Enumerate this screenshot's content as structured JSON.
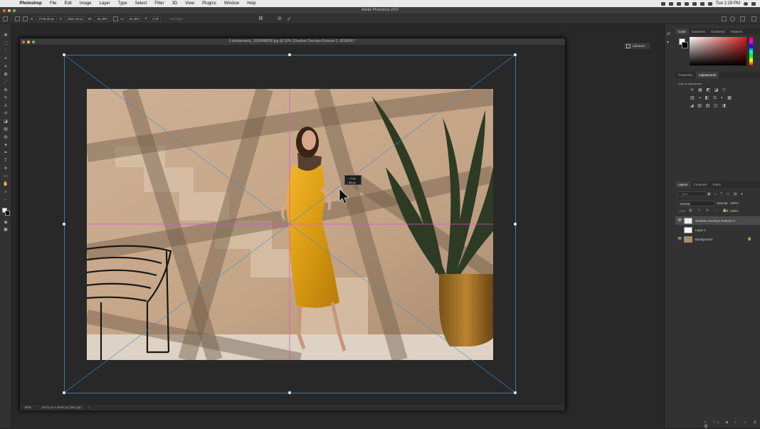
{
  "menubar": {
    "app": "Photoshop",
    "items": [
      "File",
      "Edit",
      "Image",
      "Layer",
      "Type",
      "Select",
      "Filter",
      "3D",
      "View",
      "Plugins",
      "Window",
      "Help"
    ],
    "clock": "Tue 1:29 PM"
  },
  "titlebar": {
    "title": "Adobe Photoshop 2022"
  },
  "options": {
    "x_label": "X:",
    "x_value": "2736.00 px",
    "y_label": "Y:",
    "y_value": "1824.00 px",
    "w_label": "W:",
    "w_value": "36.49%",
    "h_label": "H:",
    "h_value": "36.49%",
    "angle_value": "0.00",
    "interp_label": "Anti-alias"
  },
  "document": {
    "tab_title": "3 shutterstock_1695848628.jpg @ 50% (Shadow Overlays Exterior-3, RGB/8#) *",
    "zoom": "50%",
    "doc_size": "5472 px x 3648 px (350 ppi)"
  },
  "transform_tooltip": {
    "line1": "0 px",
    "line2": "88 px"
  },
  "libraries": {
    "label": "Libraries"
  },
  "color_panel": {
    "tabs": [
      "Color",
      "Swatches",
      "Gradients",
      "Patterns"
    ],
    "active": "Color",
    "accent": "#d31f1f"
  },
  "adjust_panel": {
    "tabs": [
      "Properties",
      "Adjustments"
    ],
    "active": "Adjustments",
    "hint": "Add an adjustment"
  },
  "layers_panel": {
    "tabs": [
      "Layers",
      "Channels",
      "Paths"
    ],
    "active": "Layers",
    "kind_placeholder": "Kind",
    "blend_mode": "Multiply",
    "opacity_label": "Opacity:",
    "opacity_value": "100%",
    "fill_label": "Fill:",
    "fill_value": "100%",
    "lock_label": "Lock:",
    "layers": [
      {
        "name": "Shadow Overlays Exterior-3",
        "visible": true,
        "selected": true
      },
      {
        "name": "Layer 1",
        "visible": false,
        "selected": false
      },
      {
        "name": "Background",
        "visible": true,
        "selected": false
      }
    ]
  }
}
